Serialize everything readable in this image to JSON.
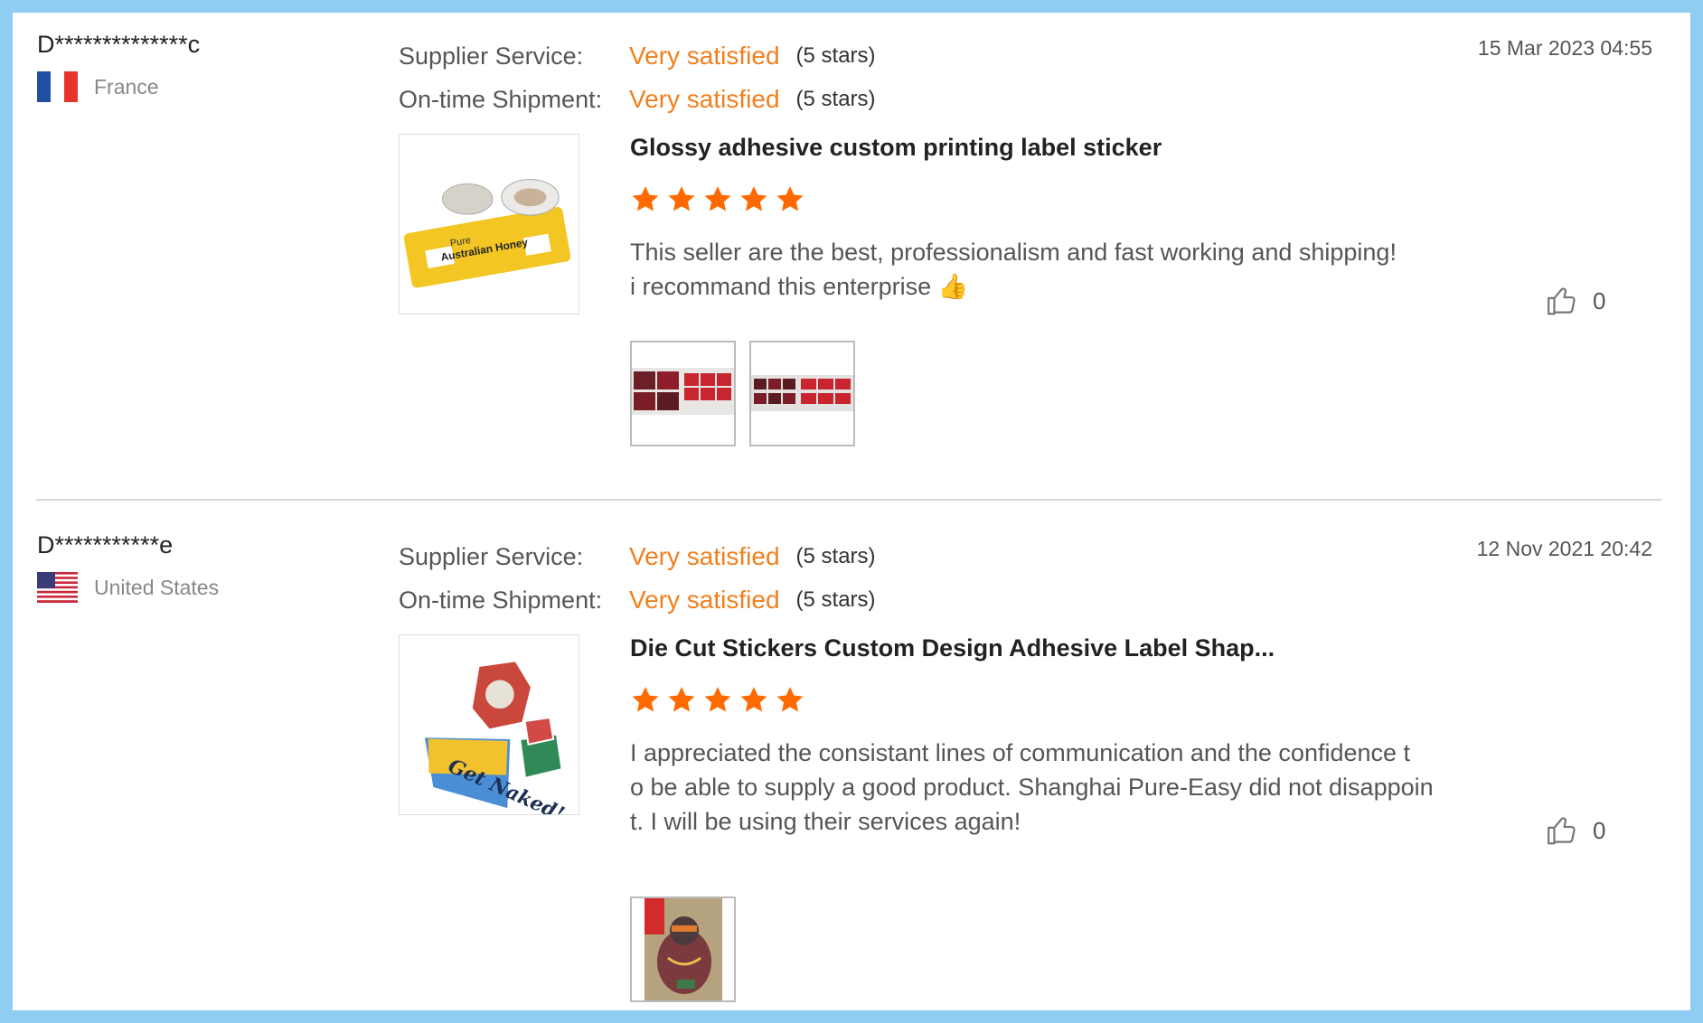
{
  "reviews": [
    {
      "buyer_name": "D**************c",
      "country": "France",
      "supplier_service_label": "Supplier Service:",
      "supplier_service_value": "Very satisfied",
      "supplier_service_stars": "(5 stars)",
      "shipment_label": "On-time Shipment:",
      "shipment_value": "Very satisfied",
      "shipment_stars": "(5 stars)",
      "date": "15 Mar 2023 04:55",
      "product_title": "Glossy adhesive custom printing label sticker",
      "rating": 5,
      "text_lines": [
        "This seller are the best, professionalism and fast working and shipping!",
        "i recommand this enterprise 👍"
      ],
      "helpful_count": "0",
      "product_image_text": [
        "Pure",
        "Australian Honey"
      ]
    },
    {
      "buyer_name": "D***********e",
      "country": "United States",
      "supplier_service_label": "Supplier Service:",
      "supplier_service_value": "Very satisfied",
      "supplier_service_stars": "(5 stars)",
      "shipment_label": "On-time Shipment:",
      "shipment_value": "Very satisfied",
      "shipment_stars": "(5 stars)",
      "date": "12 Nov 2021 20:42",
      "product_title": "Die Cut Stickers Custom Design Adhesive Label Shap...",
      "rating": 5,
      "text_lines": [
        "I appreciated the consistant lines of communication and the confidence t",
        "o be able to supply a good product. Shanghai Pure-Easy did not disappoin",
        "t. I will be using their services again!"
      ],
      "helpful_count": "0",
      "product_image_text": [
        "Get Naked!"
      ]
    }
  ],
  "colors": {
    "accent": "#f17f1e",
    "star": "#ff6a00",
    "border": "#8fcdf3"
  },
  "icons": {
    "like": "thumbs-up-icon",
    "star": "star-icon",
    "flag_fr": "flag-france-icon",
    "flag_us": "flag-us-icon"
  }
}
